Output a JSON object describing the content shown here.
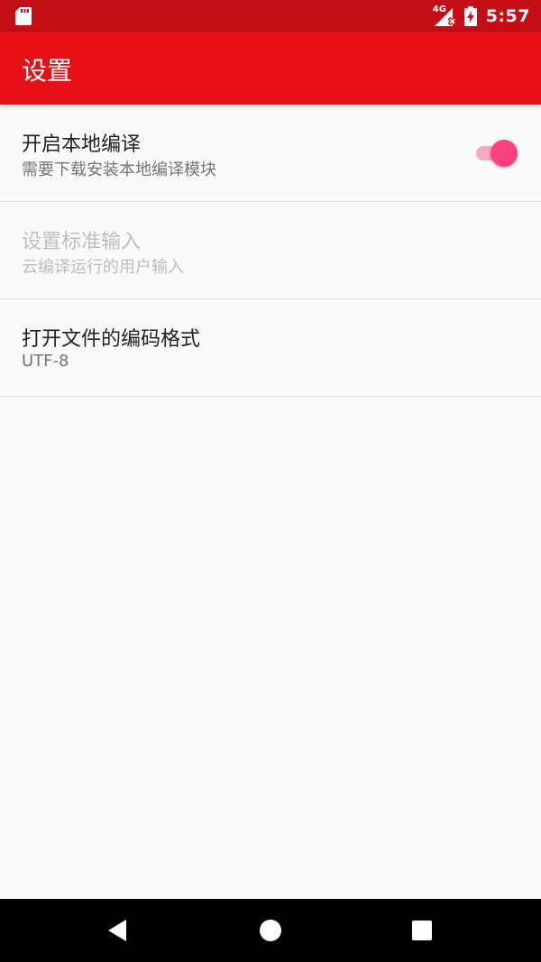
{
  "status_bar": {
    "network_label": "4G",
    "time": "5:57"
  },
  "app_bar": {
    "title": "设置"
  },
  "preferences": [
    {
      "title": "开启本地编译",
      "summary": "需要下载安装本地编译模块",
      "switch_on": true,
      "enabled": true
    },
    {
      "title": "设置标准输入",
      "summary": "云编译运行的用户输入",
      "enabled": false
    },
    {
      "title": "打开文件的编码格式",
      "summary": "UTF-8",
      "enabled": true
    }
  ],
  "colors": {
    "status_bar": "#c20e14",
    "app_bar": "#e81016",
    "accent": "#ff4081",
    "background": "#fafafa"
  },
  "icons": {
    "status_left": "sd-card-icon",
    "signal": "signal-no-data-icon",
    "battery": "battery-charging-icon",
    "nav": [
      "back-icon",
      "home-icon",
      "recents-icon"
    ]
  }
}
